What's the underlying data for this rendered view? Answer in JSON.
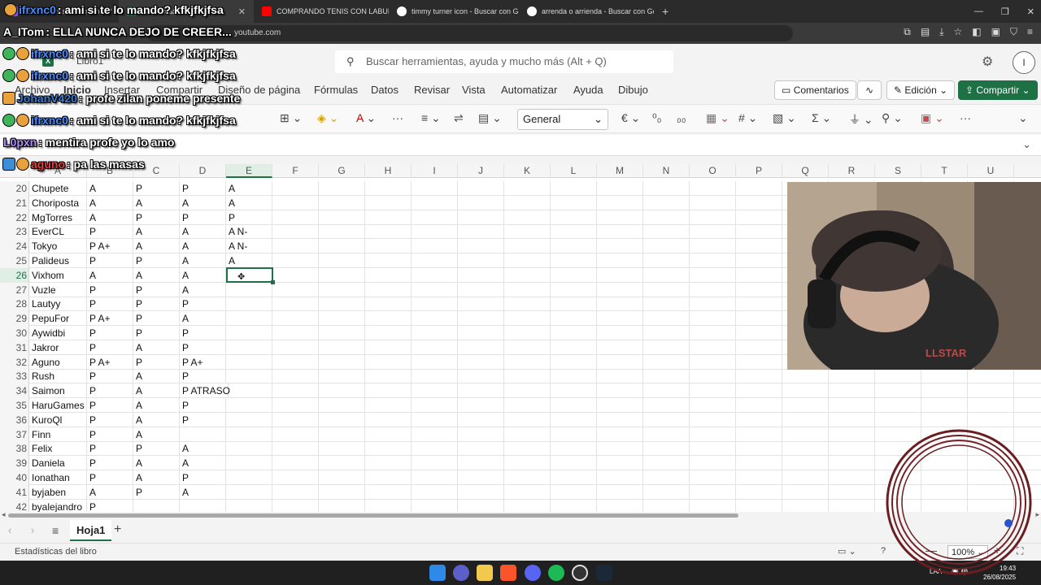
{
  "browser": {
    "tabs": [
      {
        "label": "ifrxnc0: ami si te lo mando? kfkjfkjfsa",
        "icon": "streamer-icon",
        "active": false
      },
      {
        "label": "Libro1.xlsx",
        "icon": "excel-icon",
        "active": true
      },
      {
        "label": "COMPRANDO TENIS CON LABUBU",
        "icon": "youtube-icon",
        "active": false
      },
      {
        "label": "timmy turner icon - Buscar con Goog",
        "icon": "google-icon",
        "active": false
      },
      {
        "label": "arrenda o arrienda - Buscar con Goo",
        "icon": "google-icon",
        "active": false
      }
    ],
    "url": "youtube.com",
    "colors": {
      "excel_green": "#1e7145",
      "tabbar": "#2b2b2b"
    }
  },
  "excel": {
    "filename": "Libro1",
    "search_placeholder": "Buscar herramientas, ayuda y mucho más (Alt + Q)",
    "avatar_letter": "I",
    "menu": [
      "Archivo",
      "Inicio",
      "Insertar",
      "Compartir",
      "Diseño de página",
      "Fórmulas",
      "Datos",
      "Revisar",
      "Vista",
      "Automatizar",
      "Ayuda",
      "Dibujo"
    ],
    "comments_label": "Comentarios",
    "edit_mode_label": "Edición",
    "share_label": "Compartir",
    "number_format": "General",
    "columns": [
      "A",
      "B",
      "C",
      "D",
      "E",
      "F",
      "G",
      "H",
      "I",
      "J",
      "K",
      "L",
      "M",
      "N",
      "O",
      "P",
      "Q",
      "R",
      "S",
      "T",
      "U"
    ],
    "rows": [
      {
        "n": "20",
        "a": "Chupete",
        "b": "A",
        "c": "P",
        "d": "P",
        "e": "A"
      },
      {
        "n": "21",
        "a": "Choriposta",
        "b": "A",
        "c": "A",
        "d": "A",
        "e": "A"
      },
      {
        "n": "22",
        "a": "MgTorres",
        "b": "A",
        "c": "P",
        "d": "P",
        "e": "P"
      },
      {
        "n": "23",
        "a": "EverCL",
        "b": "P",
        "c": "A",
        "d": "A",
        "e": "A N-"
      },
      {
        "n": "24",
        "a": "Tokyo",
        "b": "P A+",
        "c": "A",
        "d": "A",
        "e": "A N-"
      },
      {
        "n": "25",
        "a": "Palideus",
        "b": "P",
        "c": "P",
        "d": "A",
        "e": "A"
      },
      {
        "n": "26",
        "a": "Vixhom",
        "b": "A",
        "c": "A",
        "d": "A",
        "e": ""
      },
      {
        "n": "27",
        "a": "Vuzle",
        "b": "P",
        "c": "P",
        "d": "A",
        "e": ""
      },
      {
        "n": "28",
        "a": "Lautyy",
        "b": "P",
        "c": "P",
        "d": "P",
        "e": ""
      },
      {
        "n": "29",
        "a": "PepuFor",
        "b": "P A+",
        "c": "P",
        "d": "A",
        "e": ""
      },
      {
        "n": "30",
        "a": "Aywidbi",
        "b": "P",
        "c": "P",
        "d": "P",
        "e": ""
      },
      {
        "n": "31",
        "a": "Jakror",
        "b": "P",
        "c": "A",
        "d": "P",
        "e": ""
      },
      {
        "n": "32",
        "a": "Aguno",
        "b": "P A+",
        "c": "P",
        "d": "P A+",
        "e": ""
      },
      {
        "n": "33",
        "a": "Rush",
        "b": "P",
        "c": "A",
        "d": "P",
        "e": ""
      },
      {
        "n": "34",
        "a": "Saimon",
        "b": "P",
        "c": "A",
        "d": "P ATRASO",
        "e": ""
      },
      {
        "n": "35",
        "a": "HaruGames",
        "b": "P",
        "c": "A",
        "d": "P",
        "e": ""
      },
      {
        "n": "36",
        "a": "KuroQl",
        "b": "P",
        "c": "A",
        "d": "P",
        "e": ""
      },
      {
        "n": "37",
        "a": "Finn",
        "b": "P",
        "c": "A",
        "d": "",
        "e": ""
      },
      {
        "n": "38",
        "a": "Felix",
        "b": "P",
        "c": "P",
        "d": "A",
        "e": ""
      },
      {
        "n": "39",
        "a": "Daniela",
        "b": "P",
        "c": "A",
        "d": "A",
        "e": ""
      },
      {
        "n": "40",
        "a": "Ionathan",
        "b": "P",
        "c": "A",
        "d": "P",
        "e": ""
      },
      {
        "n": "41",
        "a": "byjaben",
        "b": "A",
        "c": "P",
        "d": "A",
        "e": ""
      },
      {
        "n": "42",
        "a": "byalejandro",
        "b": "P",
        "c": "",
        "d": "",
        "e": ""
      }
    ],
    "selected_cell": "E26",
    "sheet_tab": "Hoja1",
    "status_text": "Estadísticas del libro",
    "zoom": "100%"
  },
  "chat": [
    {
      "user": "ifrxnc0",
      "msg": ": ami si te lo mando? kfkjfkjfsa",
      "color": "#4a8cff"
    },
    {
      "user": "A_ITom",
      "msg": " : ELLA NUNCA DEJO DE CREER...",
      "color": "#ffffff"
    },
    {
      "user": "ifrxnc0",
      "msg": " : ami si te lo mando? kfkjfkjfsa",
      "color": "#4a8cff"
    },
    {
      "user": "ifrxnc0",
      "msg": " : ami si te lo mando? kfkjfkjfsa",
      "color": "#4a8cff"
    },
    {
      "user": "JohanV420",
      "msg": " : profe zilan poneme presente",
      "color": "#3b7bd4"
    },
    {
      "user": "ifrxnc0",
      "msg": " : ami si te lo mando? kfkjfkjfsa",
      "color": "#4a8cff"
    },
    {
      "user": "L0pxn",
      "msg": " : mentira profe yo lo amo",
      "color": "#b28cff"
    },
    {
      "user": "aguno",
      "msg": " : pa las masas",
      "color": "#e04040"
    }
  ],
  "taskbar": {
    "time": "19:43",
    "date": "26/08/2025",
    "lang": "LAA"
  }
}
